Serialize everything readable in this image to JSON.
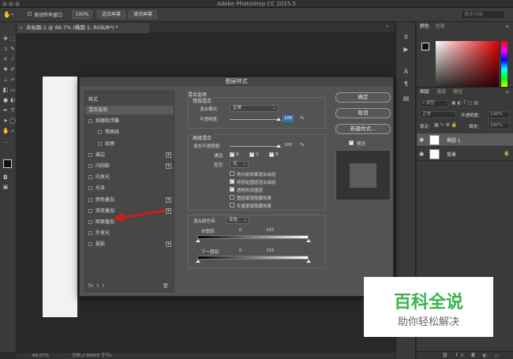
{
  "app": {
    "title": "Adobe Photoshop CC 2015.5"
  },
  "options_bar": {
    "scroll_all_windows": "滚动所有窗口",
    "zoom_pct": "100%",
    "fit_screen": "适合屏幕",
    "fill_screen": "填充屏幕",
    "workspace": "基本功能"
  },
  "document": {
    "tab_label": "未标题-1 @ 66.7% (椭圆 1, RGB/8*) *"
  },
  "status": {
    "zoom": "66.67%",
    "doc_info": "文档:2.96M/0 字节"
  },
  "panels": {
    "color_tab": "颜色",
    "swatches_tab": "色板",
    "layers_tab": "图层",
    "channels_tab": "通道",
    "paths_tab": "路径",
    "kind_filter": "类型",
    "blend_mode": "正常",
    "opacity_label": "不透明度:",
    "opacity_value": "100%",
    "lock_label": "锁定:",
    "fill_label": "填充:",
    "fill_value": "100%",
    "layers": [
      {
        "name": "椭圆 1",
        "selected": true
      },
      {
        "name": "背景",
        "selected": false
      }
    ]
  },
  "dialog": {
    "title": "图层样式",
    "styles_header": "样式",
    "styles": [
      {
        "label": "混合选项",
        "checkbox": false,
        "selected": true,
        "plus": false,
        "indent": false
      },
      {
        "label": "斜面和浮雕",
        "checkbox": true,
        "selected": false,
        "plus": false,
        "indent": false
      },
      {
        "label": "等高线",
        "checkbox": true,
        "selected": false,
        "plus": false,
        "indent": true
      },
      {
        "label": "纹理",
        "checkbox": true,
        "selected": false,
        "plus": false,
        "indent": true
      },
      {
        "label": "描边",
        "checkbox": true,
        "selected": false,
        "plus": true,
        "indent": false
      },
      {
        "label": "内阴影",
        "checkbox": true,
        "selected": false,
        "plus": true,
        "indent": false
      },
      {
        "label": "内发光",
        "checkbox": true,
        "selected": false,
        "plus": false,
        "indent": false
      },
      {
        "label": "光泽",
        "checkbox": true,
        "selected": false,
        "plus": false,
        "indent": false
      },
      {
        "label": "颜色叠加",
        "checkbox": true,
        "selected": false,
        "plus": true,
        "indent": false
      },
      {
        "label": "渐变叠加",
        "checkbox": true,
        "selected": false,
        "plus": true,
        "indent": false
      },
      {
        "label": "图案叠加",
        "checkbox": true,
        "selected": false,
        "plus": false,
        "indent": false
      },
      {
        "label": "外发光",
        "checkbox": true,
        "selected": false,
        "plus": false,
        "indent": false
      },
      {
        "label": "投影",
        "checkbox": true,
        "selected": false,
        "plus": true,
        "indent": false
      }
    ],
    "list_footer": "fx.  ⇧  ⇩",
    "blend_options_title": "混合选项",
    "general_title": "常规混合",
    "blend_mode_label": "混合模式:",
    "blend_mode_value": "正常",
    "opacity_label": "不透明度:",
    "opacity_value": "100",
    "pct": "%",
    "advanced_title": "高级混合",
    "fill_opacity_label": "填充不透明度:",
    "fill_opacity_value": "100",
    "channels_label": "通道:",
    "ch_r": "R",
    "ch_g": "G",
    "ch_b": "B",
    "knockout_label": "挖空:",
    "knockout_value": "无",
    "opt1": "将内部效果混合成组",
    "opt2": "将剪贴图层混合成组",
    "opt3": "透明形状图层",
    "opt4": "图层蒙版隐藏效果",
    "opt5": "矢量蒙版隐藏效果",
    "blend_if_label": "混合颜色带:",
    "blend_if_value": "灰色",
    "this_layer": "本图层:",
    "under_layer": "下一图层:",
    "val_0": "0",
    "val_255": "255",
    "ok": "确定",
    "cancel": "取消",
    "new_style": "新建样式...",
    "preview": "预览"
  },
  "watermark": {
    "brand": "百科全说",
    "tagline": "助你轻松解决"
  }
}
